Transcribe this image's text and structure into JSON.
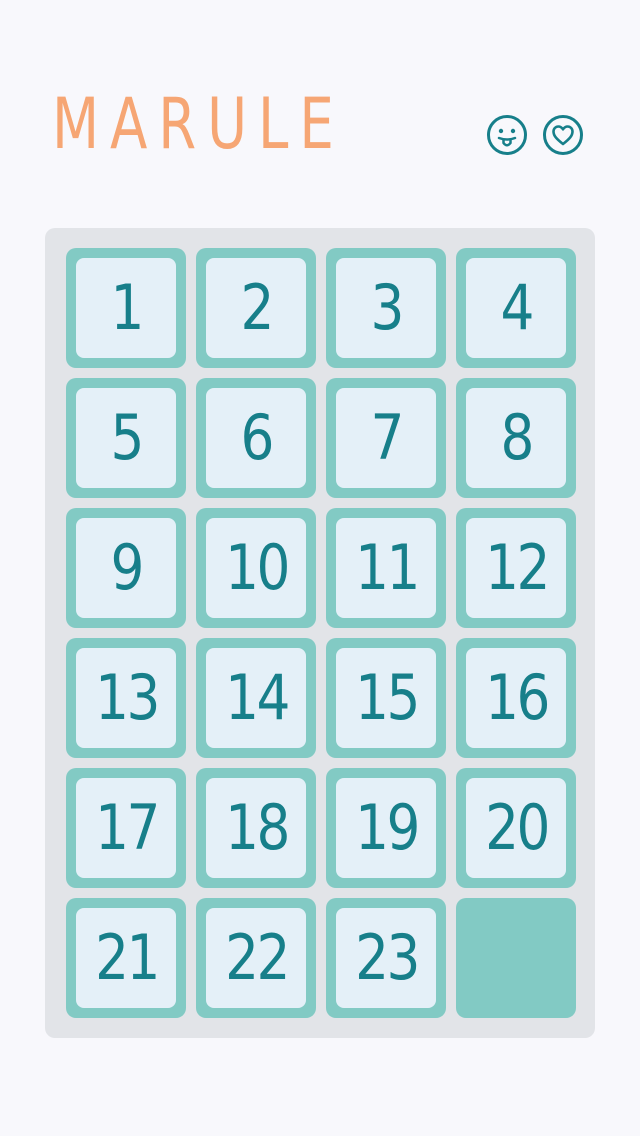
{
  "header": {
    "title": "MARULE",
    "icons": [
      {
        "name": "smiley-tongue-icon"
      },
      {
        "name": "heart-icon"
      }
    ]
  },
  "colors": {
    "background": "#f8f8fc",
    "title": "#f6a674",
    "board": "#e2e4e8",
    "tile_frame": "#82cac4",
    "tile_face": "#e4f0f8",
    "tile_number": "#177f8a",
    "icon": "#177f8a"
  },
  "board": {
    "columns": 4,
    "rows": 6,
    "tiles": [
      "1",
      "2",
      "3",
      "4",
      "5",
      "6",
      "7",
      "8",
      "9",
      "10",
      "11",
      "12",
      "13",
      "14",
      "15",
      "16",
      "17",
      "18",
      "19",
      "20",
      "21",
      "22",
      "23"
    ],
    "empty_slot": 24
  }
}
